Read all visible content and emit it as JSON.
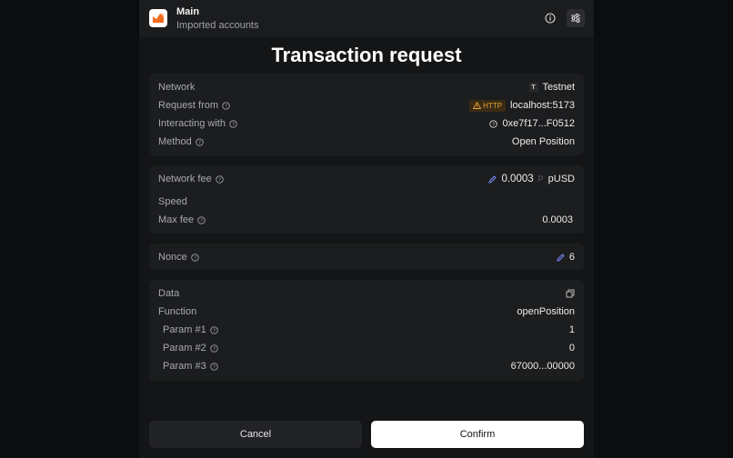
{
  "header": {
    "account_name": "Main",
    "account_subtitle": "Imported accounts"
  },
  "title": "Transaction request",
  "details": {
    "network_label": "Network",
    "network_badge": "T",
    "network_value": "Testnet",
    "request_from_label": "Request from",
    "request_from_badge": "HTTP",
    "request_from_value": "localhost:5173",
    "interacting_with_label": "Interacting with",
    "interacting_with_value": "0xe7f17...F0512",
    "method_label": "Method",
    "method_value": "Open Position"
  },
  "fee": {
    "network_fee_label": "Network fee",
    "network_fee_value": "0.0003",
    "token_badge": "P",
    "token_symbol": "pUSD",
    "speed_label": "Speed",
    "max_fee_label": "Max fee",
    "max_fee_value": "0.0003"
  },
  "nonce": {
    "label": "Nonce",
    "value": "6"
  },
  "data": {
    "label": "Data",
    "function_label": "Function",
    "function_value": "openPosition",
    "params": [
      {
        "label": "Param #1",
        "value": "1"
      },
      {
        "label": "Param #2",
        "value": "0"
      },
      {
        "label": "Param #3",
        "value": "67000...00000"
      }
    ]
  },
  "buttons": {
    "cancel": "Cancel",
    "confirm": "Confirm"
  },
  "colors": {
    "accent_edit": "#7b8cff",
    "http_badge_bg": "#3a2c14",
    "http_badge_fg": "#e8a33a",
    "logo": "#f26b1d"
  }
}
